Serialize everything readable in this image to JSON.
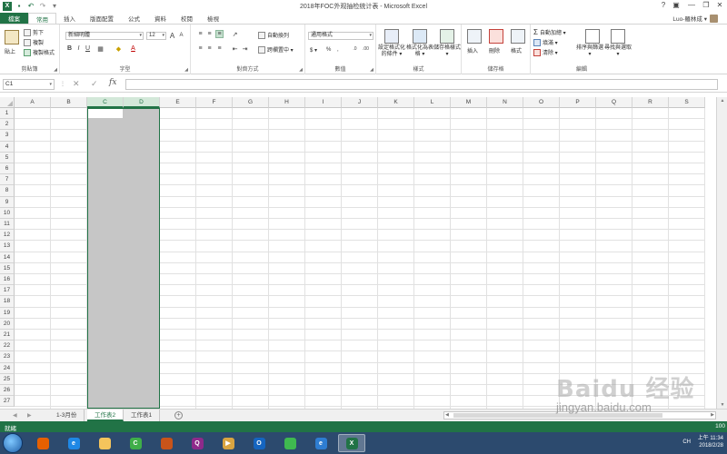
{
  "window": {
    "title": "2018年FOC外观抽检统计表 - Microsoft Excel",
    "controls": [
      "?",
      "▣",
      "—",
      "❐",
      "✕"
    ]
  },
  "tabs": [
    "檔案",
    "常用",
    "插入",
    "版面配置",
    "公式",
    "資料",
    "校閱",
    "檢視"
  ],
  "account": {
    "name": "Luo-羅林成 ▾"
  },
  "ribbon": {
    "clipboard": {
      "label": "剪貼簿",
      "paste": "貼上",
      "cut": "剪下",
      "copy": "複製",
      "format_painter": "複製格式"
    },
    "font": {
      "label": "字型",
      "font_name": "新細明體",
      "font_size": "12",
      "bold": "B",
      "italic": "I",
      "underline": "U",
      "grow": "A",
      "shrink": "A",
      "fill_color_letter": "A"
    },
    "alignment": {
      "label": "對齊方式",
      "wrap": "自動換列",
      "merge": "跨欄置中 ▾"
    },
    "number": {
      "label": "數值",
      "format": "通用格式",
      "currency": "$ ▾",
      "percent": "%",
      "comma": ","
    },
    "styles": {
      "label": "樣式",
      "conditional": "設定格式化的條件 ▾",
      "as_table": "格式化為表格 ▾",
      "cell_styles": "儲存格樣式 ▾"
    },
    "cells": {
      "label": "儲存格",
      "insert": "插入",
      "delete": "刪除",
      "format": "格式"
    },
    "editing": {
      "label": "編輯",
      "autosum": "自動加總 ▾",
      "fill": "填滿 ▾",
      "clear": "清除 ▾",
      "sort": "排序與篩選 ▾",
      "find": "尋找與選取 ▾"
    }
  },
  "formula_bar": {
    "name_box": "C1",
    "fx": "fx",
    "content": ""
  },
  "grid": {
    "columns": [
      "A",
      "B",
      "C",
      "D",
      "E",
      "F",
      "G",
      "H",
      "I",
      "J",
      "K",
      "L",
      "M",
      "N",
      "O",
      "P",
      "Q",
      "R",
      "S"
    ],
    "rows": [
      "1",
      "2",
      "3",
      "4",
      "5",
      "6",
      "7",
      "8",
      "9",
      "10",
      "11",
      "12",
      "13",
      "14",
      "15",
      "16",
      "17",
      "18",
      "19",
      "20",
      "21",
      "22",
      "23",
      "24",
      "25",
      "26",
      "27"
    ],
    "selected_columns": [
      "C",
      "D"
    ],
    "active_cell": "C1"
  },
  "sheets": {
    "tabs": [
      "1-3月份",
      "工作表2",
      "工作表1"
    ],
    "active": "工作表2",
    "add": "+"
  },
  "status": {
    "text": "就緒",
    "zoom": "100"
  },
  "taskbar": {
    "apps": [
      {
        "name": "firefox-icon",
        "glyph": "",
        "color": "#e66000",
        "active": false
      },
      {
        "name": "ie-icon",
        "glyph": "e",
        "color": "#1e88e5",
        "active": false
      },
      {
        "name": "folder-icon",
        "glyph": "",
        "color": "#f4c45c",
        "active": false
      },
      {
        "name": "security-icon",
        "glyph": "C",
        "color": "#3fae49",
        "active": false
      },
      {
        "name": "fox-icon",
        "glyph": "",
        "color": "#c8541a",
        "active": false
      },
      {
        "name": "player-icon",
        "glyph": "Q",
        "color": "#8e2a8a",
        "active": false
      },
      {
        "name": "video-icon",
        "glyph": "▶",
        "color": "#d9a441",
        "active": false
      },
      {
        "name": "outlook-icon",
        "glyph": "O",
        "color": "#1565c0",
        "active": false
      },
      {
        "name": "wechat-icon",
        "glyph": "",
        "color": "#3fb950",
        "active": false
      },
      {
        "name": "browser-icon",
        "glyph": "e",
        "color": "#2e7dd1",
        "active": false
      },
      {
        "name": "excel-icon",
        "glyph": "X",
        "color": "#217346",
        "active": true
      }
    ],
    "tray": {
      "lang": "CH",
      "time": "上午 11:34",
      "date": "2018/2/28"
    }
  },
  "watermark": {
    "logo": "Baidu 经验",
    "url": "jingyan.baidu.com"
  }
}
